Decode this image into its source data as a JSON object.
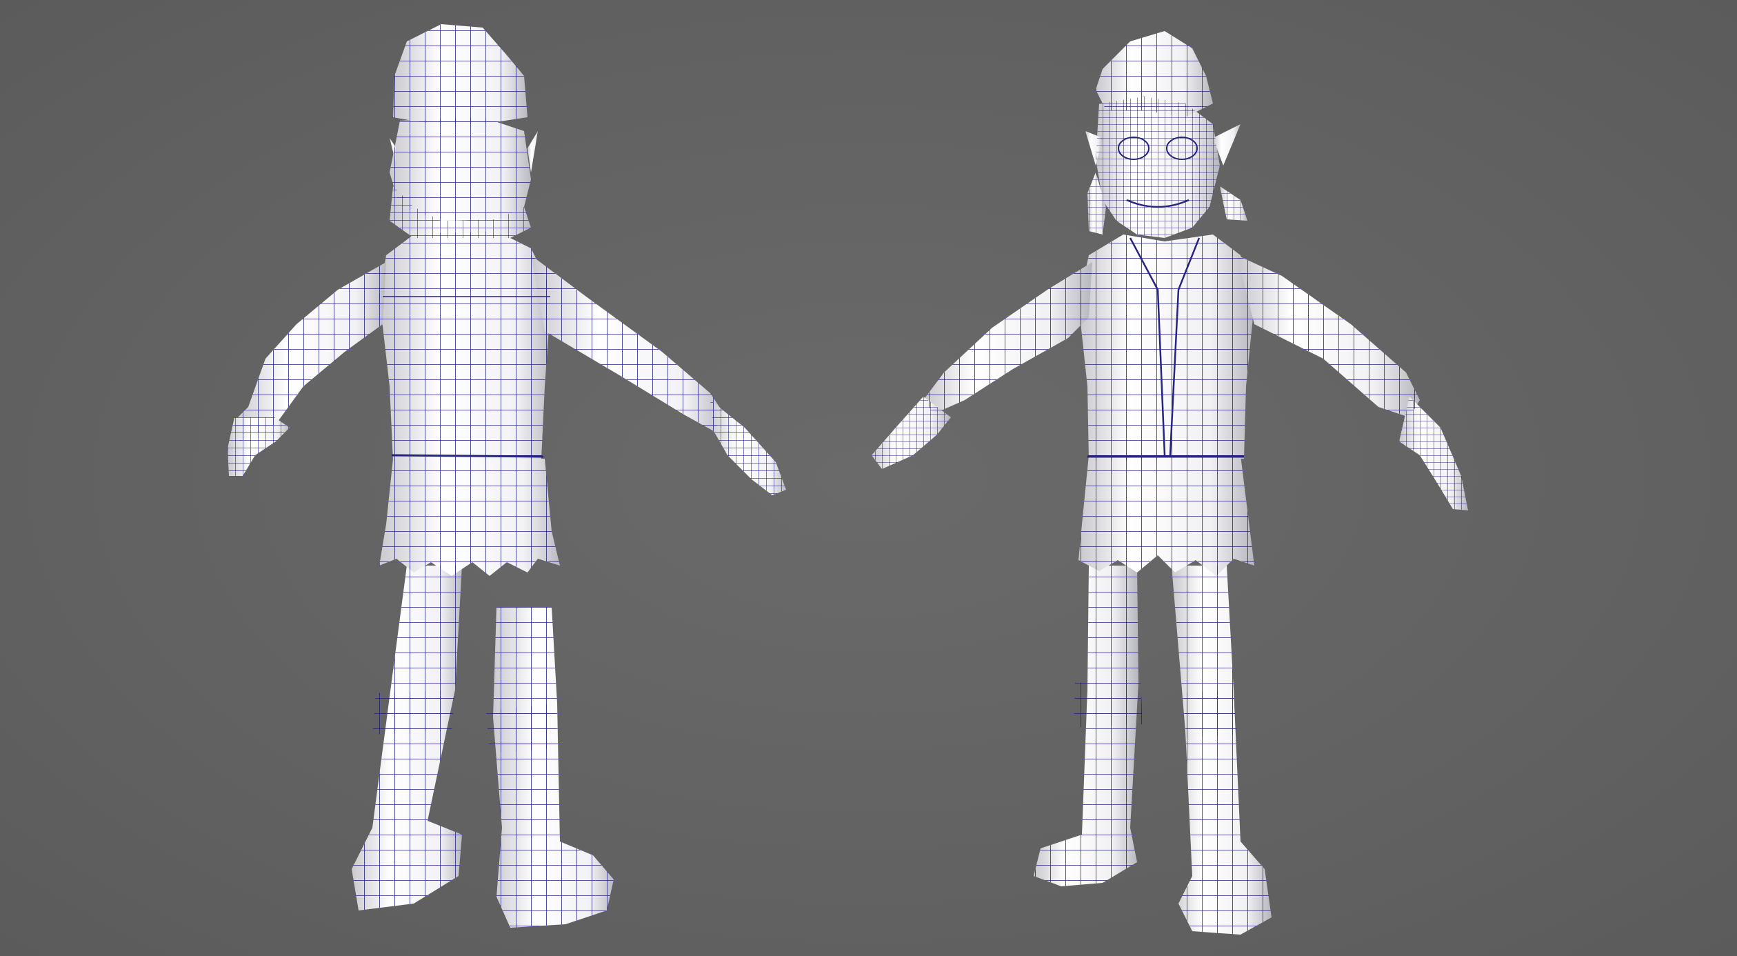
{
  "viewport": {
    "background_color": "#636363",
    "wire_color": "#1c1a7a",
    "surface_color": "#f4f4f6",
    "shadow_color": "#bdbdc4"
  },
  "models": [
    {
      "view": "back"
    },
    {
      "view": "front"
    }
  ]
}
